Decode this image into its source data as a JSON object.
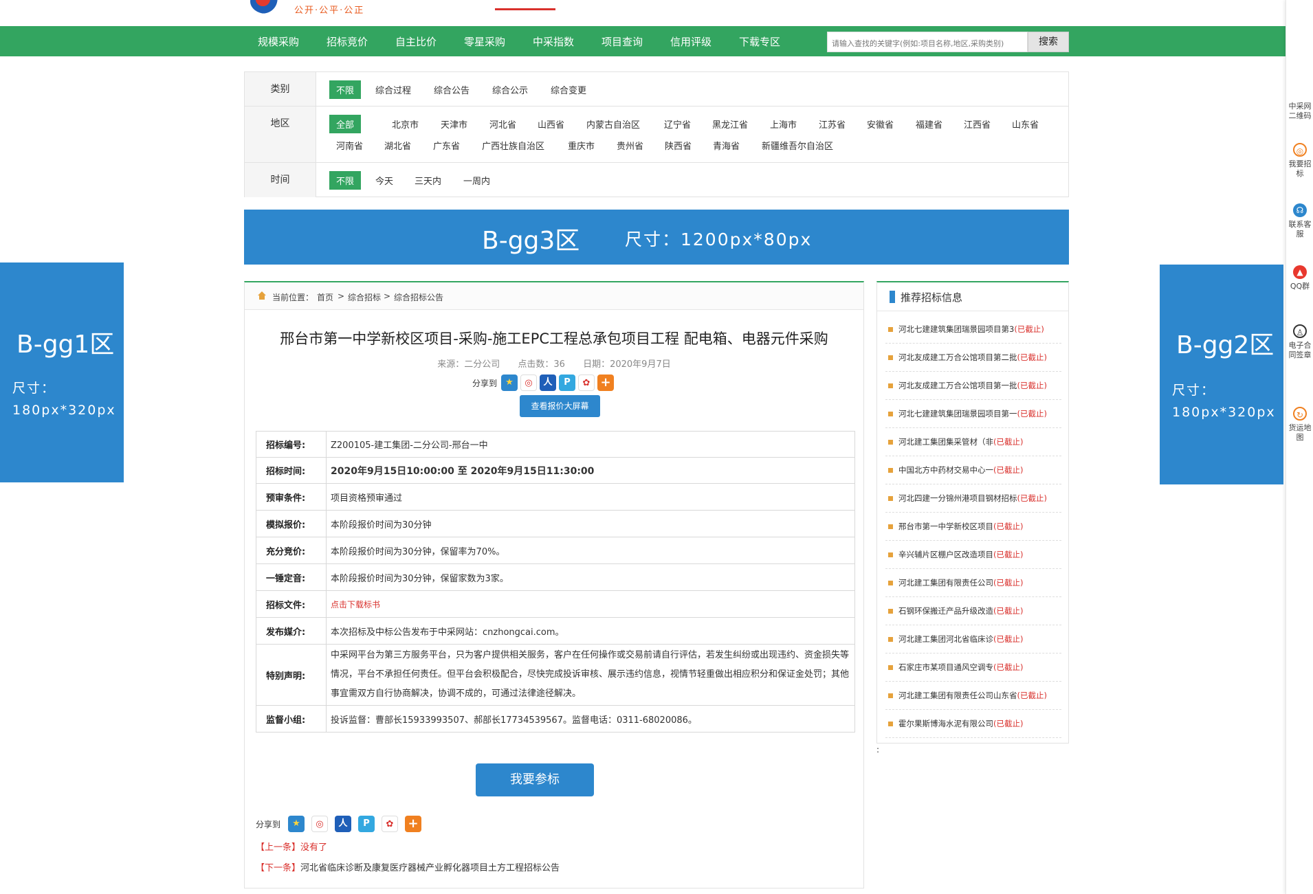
{
  "header": {
    "slogan": "公开·公平·公正"
  },
  "nav": {
    "items": [
      "规模采购",
      "招标竞价",
      "自主比价",
      "零星采购",
      "中采指数",
      "项目查询",
      "信用评级",
      "下载专区"
    ],
    "search_placeholder": "请输入查找的关键字(例如:项目名称,地区,采购类别)",
    "search_button": "搜索"
  },
  "filter": {
    "category_label": "类别",
    "category_options": [
      "不限",
      "综合过程",
      "综合公告",
      "综合公示",
      "综合变更"
    ],
    "region_label": "地区",
    "region_options": [
      "全部",
      "北京市",
      "天津市",
      "河北省",
      "山西省",
      "内蒙古自治区",
      "辽宁省",
      "黑龙江省",
      "上海市",
      "江苏省",
      "安徽省",
      "福建省",
      "江西省",
      "山东省",
      "河南省",
      "湖北省",
      "广东省",
      "广西壮族自治区",
      "重庆市",
      "贵州省",
      "陕西省",
      "青海省",
      "新疆维吾尔自治区"
    ],
    "time_label": "时间",
    "time_options": [
      "不限",
      "今天",
      "三天内",
      "一周内"
    ]
  },
  "ads": {
    "gg3_title": "B-gg3区",
    "gg3_size": "尺寸：1200px*80px",
    "gg1_title": "B-gg1区",
    "gg1_size_label": "尺寸：",
    "gg1_size": "180px*320px",
    "gg2_title": "B-gg2区",
    "gg2_size_label": "尺寸：",
    "gg2_size": "180px*320px"
  },
  "breadcrumb": {
    "prefix": "当前位置：",
    "items": [
      "首页",
      "综合招标",
      "综合招标公告"
    ],
    "sep": ">"
  },
  "article": {
    "title": "邢台市第一中学新校区项目-采购-施工EPC工程总承包项目工程 配电箱、电器元件采购",
    "source": "来源：二分公司",
    "clicks": "点击数：36",
    "date": "日期：2020年9月7日",
    "share_label": "分享到",
    "bigscreen_button": "查看报价大屏幕",
    "rows": [
      {
        "key": "招标编号:",
        "value": "Z200105-建工集团-二分公司-邢台一中"
      },
      {
        "key": "招标时间:",
        "value": "2020年9月15日10:00:00 至 2020年9月15日11:30:00"
      },
      {
        "key": "预审条件:",
        "value": "项目资格预审通过"
      },
      {
        "key": "模拟报价:",
        "value": "本阶段报价时间为30分钟"
      },
      {
        "key": "充分竞价:",
        "value": "本阶段报价时间为30分钟，保留率为70%。"
      },
      {
        "key": "一锤定音:",
        "value": "本阶段报价时间为30分钟，保留家数为3家。"
      },
      {
        "key": "招标文件:",
        "value": "点击下载标书"
      },
      {
        "key": "发布媒介:",
        "value": "本次招标及中标公告发布于中采网站：cnzhongcai.com。"
      },
      {
        "key": "特别声明:",
        "value": "中采网平台为第三方服务平台，只为客户提供相关服务，客户在任何操作或交易前请自行评估，若发生纠纷或出现违约、资金损失等情况，平台不承担任何责任。但平台会积极配合，尽快完成投诉审核、展示违约信息，视情节轻重做出相应积分和保证金处罚；其他事宜需双方自行协商解决，协调不成的，可通过法律途径解决。"
      },
      {
        "key": "监督小组:",
        "value": "投诉监督：曹部长15933993507、郝部长17734539567。监督电话：0311-68020086。"
      }
    ],
    "bid_button": "我要参标",
    "share_label_bottom": "分享到",
    "prev_tag": "【上一条】",
    "prev_text": "没有了",
    "next_tag": "【下一条】",
    "next_text": "河北省临床诊断及康复医疗器械产业孵化器项目土方工程招标公告"
  },
  "sidebar": {
    "title": "推荐招标信息",
    "expired": "(已截止)",
    "items": [
      "河北七建建筑集团瑞景园项目第3",
      "河北友成建工万合公馆项目第二批",
      "河北友成建工万合公馆项目第一批",
      "河北七建建筑集团瑞景园项目第一",
      "河北建工集团集采管材（非",
      "中国北方中药材交易中心一",
      "河北四建一分锦州港项目钢材招标",
      "邢台市第一中学新校区项目",
      "辛兴辅片区棚户区改造项目",
      "河北建工集团有限责任公司",
      "石钢环保搬迁产品升级改造",
      "河北建工集团河北省临床诊",
      "石家庄市某项目通风空调专",
      "河北建工集团有限责任公司山东省",
      "霍尔果斯博海水泥有限公司"
    ],
    "colon": ":"
  },
  "floatbar": {
    "qr": "中采网二维码",
    "bid": "我要招标",
    "service": "联系客服",
    "qq": "QQ群",
    "contract": "电子合同签章",
    "map": "货运地图"
  },
  "colors": {
    "green": "#33a560",
    "blue": "#2d87cd",
    "red": "#d9302c"
  }
}
